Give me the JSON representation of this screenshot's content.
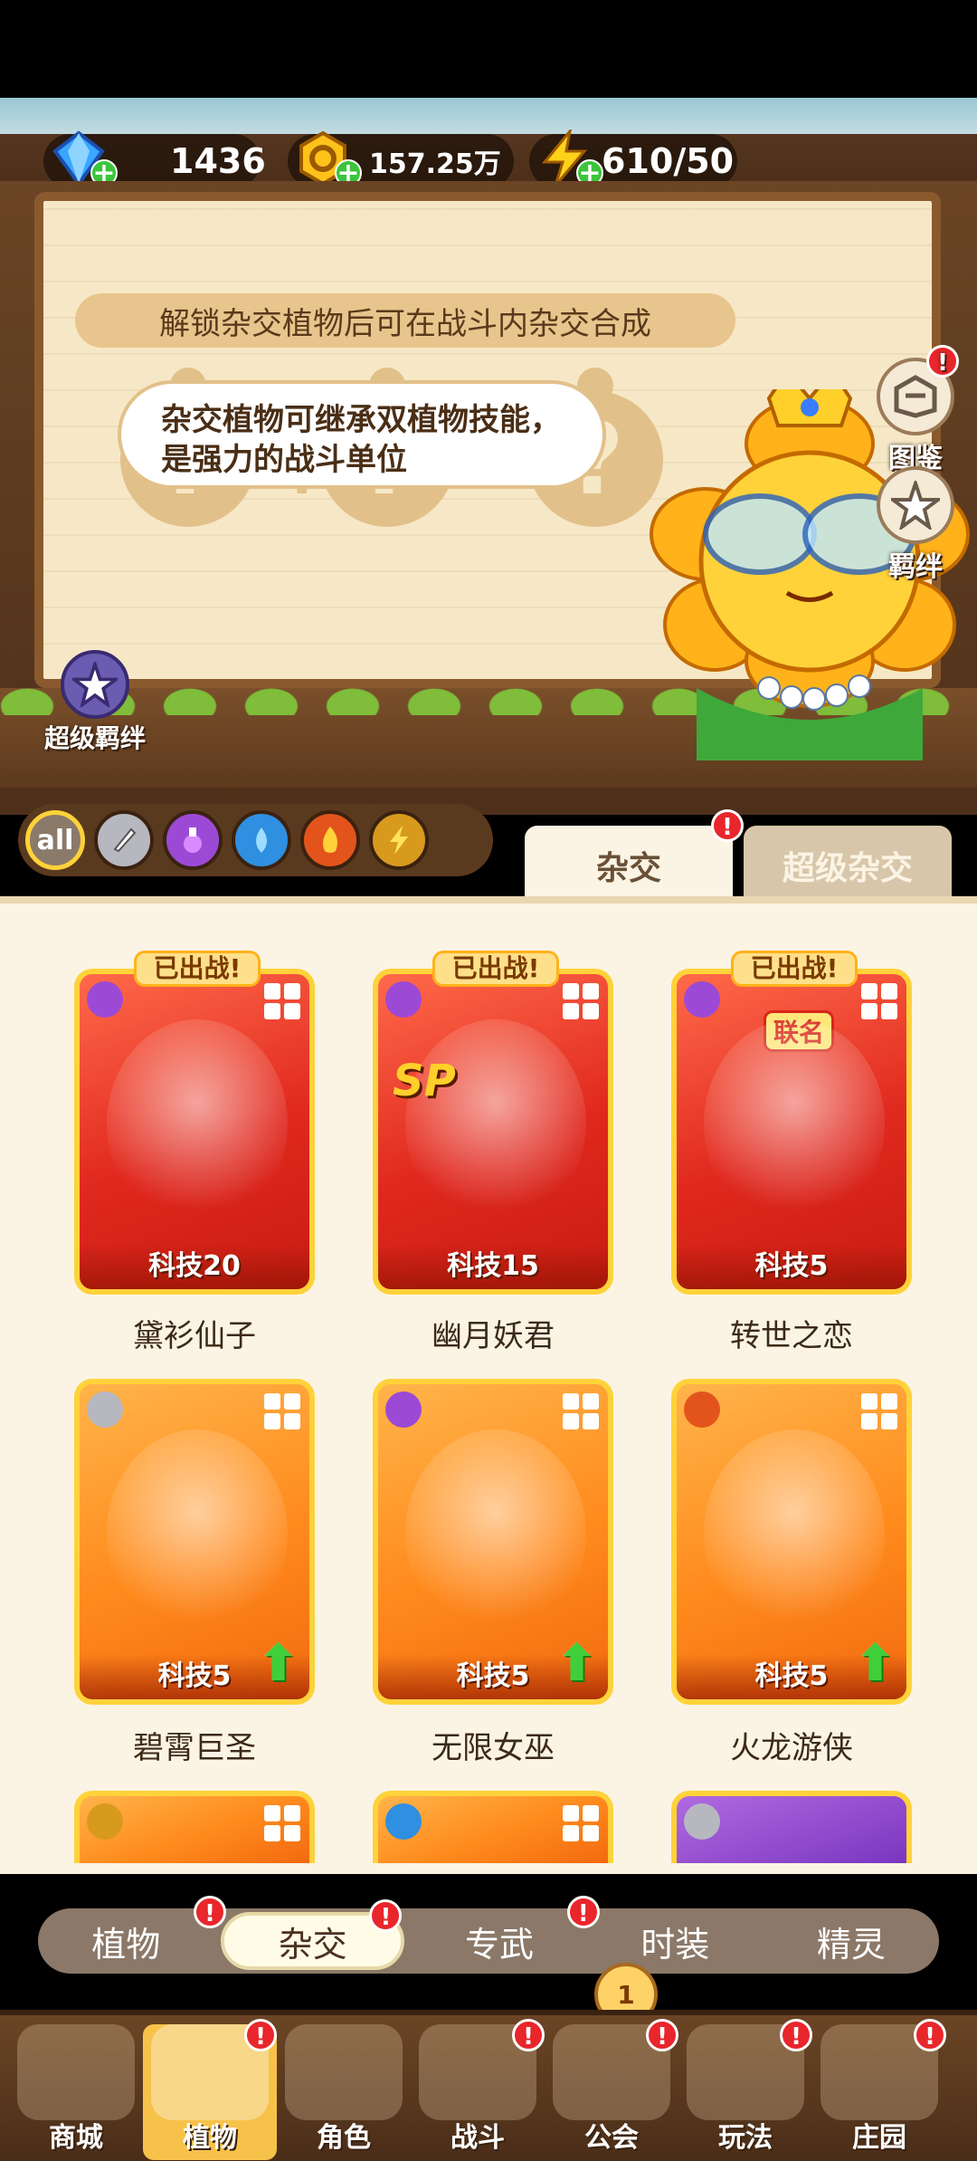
{
  "resources": {
    "gems": "1436",
    "coins": "157.25万",
    "energy": "610/50"
  },
  "board": {
    "unlock_tip": "解锁杂交植物后可在战斗内杂交合成",
    "speech": "杂交植物可继承双植物技能，是强力的战斗单位",
    "plus": "+",
    "equals": "="
  },
  "side_buttons": {
    "codex": "图鉴",
    "bond": "羁绊",
    "super_bond": "超级羁绊"
  },
  "filters": [
    "all"
  ],
  "top_tabs": {
    "hybrid": "杂交",
    "super_hybrid": "超级杂交"
  },
  "cards": [
    {
      "name": "黛衫仙子",
      "tech": "科技20",
      "deployed": "已出战!",
      "element": "purple"
    },
    {
      "name": "幽月妖君",
      "tech": "科技15",
      "deployed": "已出战!",
      "element": "purple",
      "sp": "SP"
    },
    {
      "name": "转世之恋",
      "tech": "科技5",
      "deployed": "已出战!",
      "element": "purple",
      "collab": "联名"
    },
    {
      "name": "碧霄巨圣",
      "tech": "科技5",
      "element": "sword"
    },
    {
      "name": "无限女巫",
      "tech": "科技5",
      "element": "purple"
    },
    {
      "name": "火龙游侠",
      "tech": "科技5",
      "element": "fire"
    }
  ],
  "section_tabs": [
    "植物",
    "杂交",
    "专武",
    "时装",
    "精灵"
  ],
  "bottom_nav": [
    "商城",
    "植物",
    "角色",
    "战斗",
    "公会",
    "玩法",
    "庄园"
  ],
  "guild_count": "1",
  "badge_mark": "!",
  "colors": {
    "wood": "#5b3a22",
    "board": "#f6e8c6",
    "accent": "#ffd23a",
    "red_badge": "#e8262b"
  }
}
